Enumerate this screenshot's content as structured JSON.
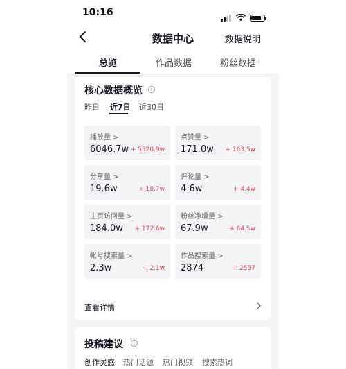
{
  "status_bar": {
    "time": "10:16"
  },
  "nav": {
    "title": "数据中心",
    "right_label": "数据说明"
  },
  "tabs": [
    {
      "label": "总览",
      "active": true
    },
    {
      "label": "作品数据",
      "active": false
    },
    {
      "label": "粉丝数据",
      "active": false
    }
  ],
  "core": {
    "title": "核心数据概览",
    "ranges": [
      {
        "label": "昨日",
        "active": false
      },
      {
        "label": "近7日",
        "active": true
      },
      {
        "label": "近30日",
        "active": false
      }
    ],
    "metrics": [
      {
        "label": "播放量 >",
        "value": "6046.7w",
        "delta": "+ 5520.9w"
      },
      {
        "label": "点赞量 >",
        "value": "171.0w",
        "delta": "+ 163.5w"
      },
      {
        "label": "分享量 >",
        "value": "19.6w",
        "delta": "+ 18.7w"
      },
      {
        "label": "评论量 >",
        "value": "4.6w",
        "delta": "+ 4.4w"
      },
      {
        "label": "主页访问量 >",
        "value": "184.0w",
        "delta": "+ 172.6w"
      },
      {
        "label": "粉丝净增量 >",
        "value": "67.9w",
        "delta": "+ 64.5w"
      },
      {
        "label": "帐号搜索量 >",
        "value": "2.3w",
        "delta": "+ 2.1w"
      },
      {
        "label": "作品搜索量 >",
        "value": "2874",
        "delta": "+ 2557"
      }
    ],
    "detail_link": "查看详情"
  },
  "suggest": {
    "title": "投稿建议",
    "tabs": [
      {
        "label": "创作灵感",
        "active": true
      },
      {
        "label": "热门话题",
        "active": false
      },
      {
        "label": "热门视频",
        "active": false
      },
      {
        "label": "搜索热词",
        "active": false
      }
    ]
  },
  "colors": {
    "accent": "#161823",
    "delta": "#e1455a",
    "card_bg": "#f4f4f6",
    "page_bg": "#f5f5f7"
  }
}
